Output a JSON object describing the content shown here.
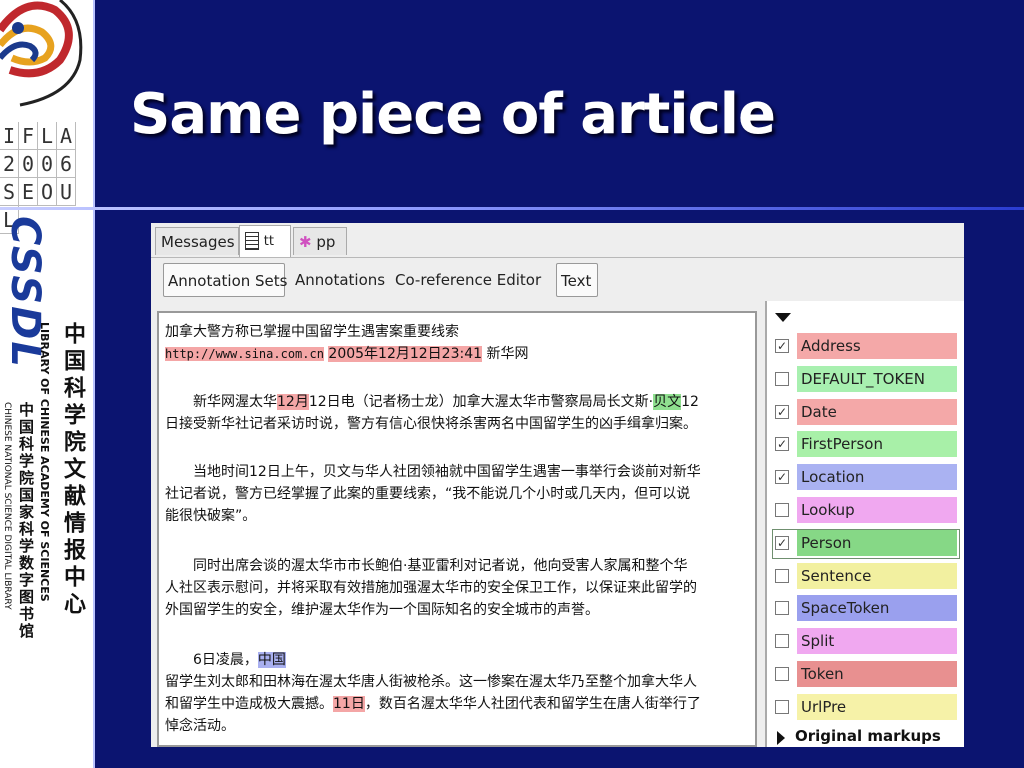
{
  "slide": {
    "title": "Same piece of article"
  },
  "logos": {
    "ifla_grid": [
      "I",
      "F",
      "L",
      "A",
      "2",
      "0",
      "0",
      "6",
      "S",
      "E",
      "O",
      "U",
      "L"
    ],
    "cssdl_mark": "CSSDL",
    "cn_name": "中国科学院文献情报中心",
    "en_name": "LIBRARY OF CHINESE ACADEMY OF SCIENCES",
    "cn_name2": "中国科学院国家科学数字图书馆",
    "en_name2": "CHINESE NATIONAL SCIENCE DIGITAL LIBRARY"
  },
  "doc_tabs": [
    {
      "label": "Messages",
      "icon": ""
    },
    {
      "label": "tt",
      "icon": "document-icon"
    },
    {
      "label": "pp",
      "icon": "atom-icon"
    }
  ],
  "view_tabs": [
    "Annotation Sets",
    "Annotations",
    "Co-reference Editor",
    "Text"
  ],
  "article": {
    "line1": "加拿大警方称已掌握中国留学生遇害案重要线索",
    "url": "http://www.sina.com.cn",
    "datetime": "2005年12月12日23:41",
    "source": "新华网",
    "p1a_pre": "新华网渥太华",
    "p1a_date": "12月",
    "p1a_mid": "12日电（记者杨士龙）加拿大渥太华市警察局局长文斯·",
    "p1a_person": "贝文",
    "p1a_post": "12",
    "p1b": "日接受新华社记者采访时说，警方有信心很快将杀害两名中国留学生的凶手缉拿归案。",
    "p2a": "当地时间12日上午，贝文与华人社团领袖就中国留学生遇害一事举行会谈前对新华",
    "p2b": "社记者说，警方已经掌握了此案的重要线索，“我不能说几个小时或几天内，但可以说",
    "p2c": "能很快破案”。",
    "p3a": "同时出席会谈的渥太华市市长鲍伯·基亚雷利对记者说，他向受害人家属和整个华",
    "p3b": "人社区表示慰问，并将采取有效措施加强渥太华市的安全保卫工作，以保证来此留学的",
    "p3c": "外国留学生的安全，维护渥太华作为一个国际知名的安全城市的声誉。",
    "p4a_pre": "6日凌晨，",
    "p4a_loc": "中国",
    "p4b": "留学生刘太郎和田林海在渥太华唐人街被枪杀。这一惨案在渥太华乃至整个加拿大华人",
    "p4c_pre": "和留学生中造成极大震撼。",
    "p4c_date": "11日",
    "p4c_post": "，数百名渥太华华人社团代表和留学生在唐人街举行了",
    "p4d": "悼念活动。"
  },
  "annotation_types": [
    {
      "label": "Address",
      "checked": true,
      "color": "#f4a8a8"
    },
    {
      "label": "DEFAULT_TOKEN",
      "checked": false,
      "color": "#a8f0b0"
    },
    {
      "label": "Date",
      "checked": true,
      "color": "#f4a8a8"
    },
    {
      "label": "FirstPerson",
      "checked": true,
      "color": "#a8f0a8"
    },
    {
      "label": "Location",
      "checked": true,
      "color": "#aab2f2"
    },
    {
      "label": "Lookup",
      "checked": false,
      "color": "#f0a8f0"
    },
    {
      "label": "Person",
      "checked": true,
      "color": "#86d886"
    },
    {
      "label": "Sentence",
      "checked": false,
      "color": "#f2f0a0"
    },
    {
      "label": "SpaceToken",
      "checked": false,
      "color": "#9aa0ee"
    },
    {
      "label": "Split",
      "checked": false,
      "color": "#f0a8f0"
    },
    {
      "label": "Token",
      "checked": false,
      "color": "#e89090"
    },
    {
      "label": "UrlPre",
      "checked": false,
      "color": "#f6f2a8"
    }
  ],
  "original_markups": "Original markups"
}
